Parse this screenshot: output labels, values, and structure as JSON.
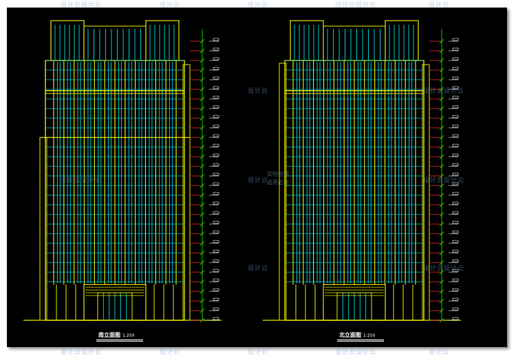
{
  "watermark": {
    "text": "设计云",
    "double_text": "设计云设计云"
  },
  "stamp": {
    "line1": "实物拍摄",
    "line2": "盗用必究"
  },
  "left_drawing": {
    "title": "南立面图",
    "scale": "1:250"
  },
  "right_drawing": {
    "title": "北立面图",
    "scale": "1:250"
  },
  "colors": {
    "background": "#000000",
    "outline": "#e6e600",
    "glazing": "#00c8c8",
    "levels": "#00cc00",
    "floor_lines": "#ff2a2a",
    "labels": "#ffffff"
  },
  "floor_count": 27
}
